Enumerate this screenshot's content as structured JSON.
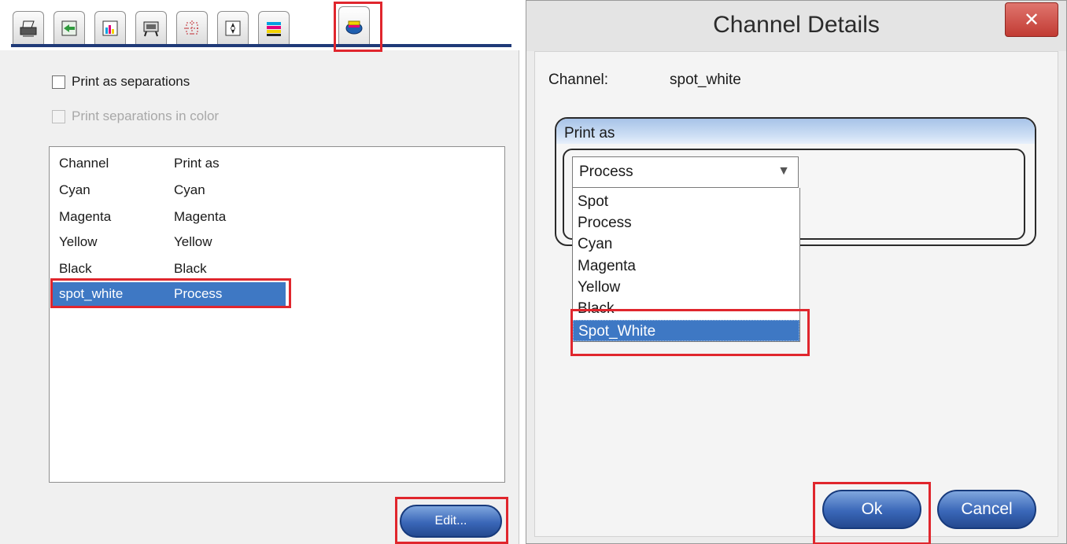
{
  "print_settings": {
    "tabs": [
      {
        "icon": "printer-icon",
        "active": false
      },
      {
        "icon": "import-arrow-icon",
        "active": false
      },
      {
        "icon": "color-bars-icon",
        "active": false
      },
      {
        "icon": "device-icon",
        "active": false
      },
      {
        "icon": "crop-marks-icon",
        "active": false
      },
      {
        "icon": "compass-target-icon",
        "active": false
      },
      {
        "icon": "color-stripes-icon",
        "active": false
      },
      {
        "icon": "ink-separations-icon",
        "active": true
      }
    ],
    "print_as_separations_label": "Print as separations",
    "print_separations_in_color_label": "Print separations in color",
    "list_headers": {
      "channel": "Channel",
      "print_as": "Print as"
    },
    "rows": [
      {
        "channel": "Cyan",
        "print_as": "Cyan"
      },
      {
        "channel": "Magenta",
        "print_as": "Magenta"
      },
      {
        "channel": "Yellow",
        "print_as": "Yellow"
      },
      {
        "channel": "Black",
        "print_as": "Black"
      },
      {
        "channel": "spot_white",
        "print_as": "Process"
      }
    ],
    "edit_button": "Edit..."
  },
  "channel_details": {
    "title": "Channel Details",
    "close_glyph": "✕",
    "channel_label": "Channel:",
    "channel_value": "spot_white",
    "print_as_label": "Print as",
    "select_value": "Process",
    "options": [
      "Spot",
      "Process",
      "Cyan",
      "Magenta",
      "Yellow",
      "Black",
      "Spot_White"
    ],
    "selected_option": "Spot_White",
    "ok_button": "Ok",
    "cancel_button": "Cancel"
  },
  "colors": {
    "highlight": "#e0262d",
    "selection": "#3e78c4",
    "button_blue": "#3a67b8",
    "tab_underline": "#1f3a78"
  }
}
